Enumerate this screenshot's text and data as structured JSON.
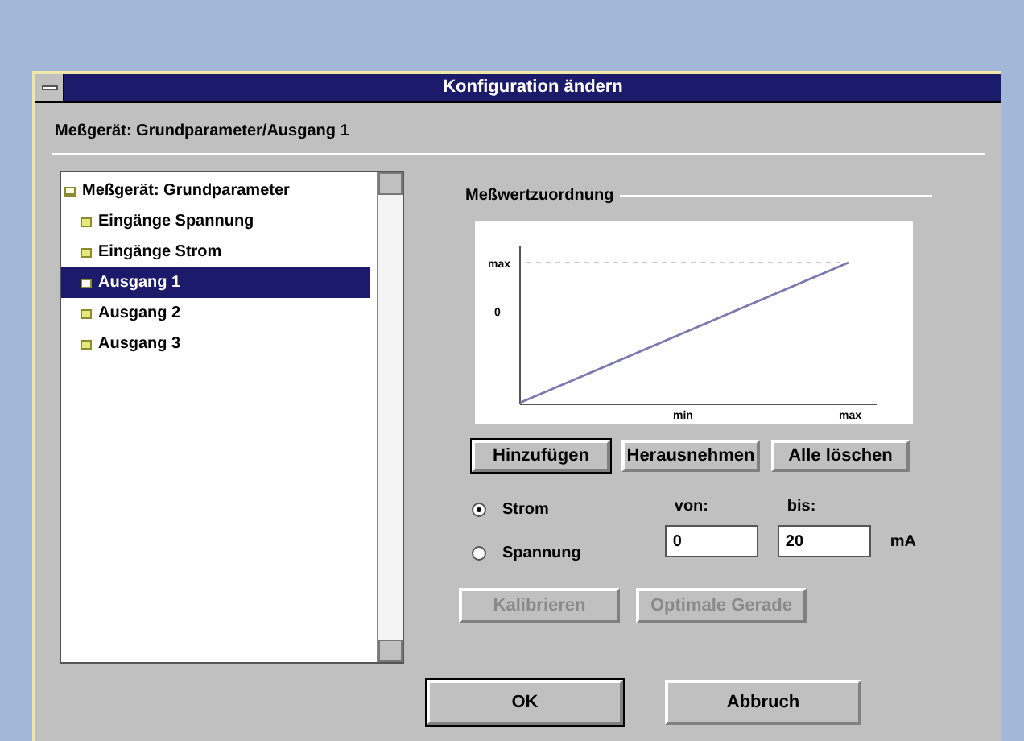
{
  "window": {
    "title": "Konfiguration ändern"
  },
  "path_label": "Meßgerät: Grundparameter/Ausgang 1",
  "tree": [
    {
      "label": "Meßgerät: Grundparameter",
      "selected": false,
      "expanded": true,
      "children": [
        {
          "label": "Eingänge Spannung",
          "selected": false
        },
        {
          "label": "Eingänge Strom",
          "selected": false
        },
        {
          "label": "Ausgang 1",
          "selected": true
        },
        {
          "label": "Ausgang 2",
          "selected": false
        },
        {
          "label": "Ausgang 3",
          "selected": false
        }
      ]
    }
  ],
  "group": {
    "title": "Meßwertzuordnung",
    "graph": {
      "y_labels": [
        "max",
        "0"
      ],
      "x_labels": [
        "min",
        "max"
      ]
    },
    "buttons": [
      {
        "label": "Hinzufügen",
        "default": true
      },
      {
        "label": "Herausnehmen",
        "default": false
      },
      {
        "label": "Alle löschen",
        "default": false
      }
    ],
    "radios": [
      {
        "label": "Strom",
        "selected": true
      },
      {
        "label": "Spannung",
        "selected": false
      }
    ],
    "range": {
      "from_label": "von:",
      "to_label": "bis:",
      "from": "0",
      "to": "20",
      "unit": "mA"
    },
    "actions": [
      {
        "label": "Kalibrieren",
        "disabled": true
      },
      {
        "label": "Optimale Gerade",
        "disabled": true
      }
    ]
  },
  "footer": [
    {
      "label": "OK",
      "default": true
    },
    {
      "label": "Abbruch",
      "default": false
    }
  ]
}
